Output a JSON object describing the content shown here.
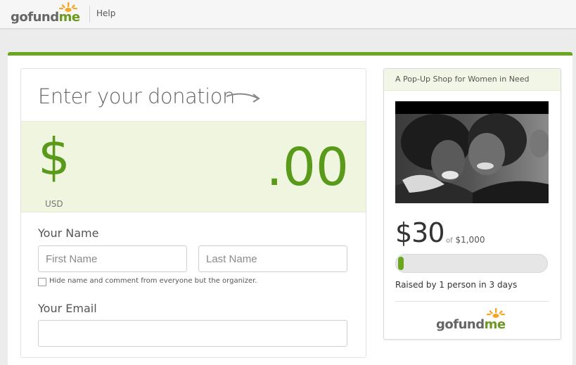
{
  "header": {
    "logo": {
      "go": "go",
      "fund": "fund",
      "me": "me"
    },
    "help_link": "Help"
  },
  "donation": {
    "title": "Enter your donation",
    "currency_symbol": "$",
    "currency_code": "USD",
    "amount_placeholder": ".00",
    "name_label": "Your Name",
    "first_name_placeholder": "First Name",
    "last_name_placeholder": "Last Name",
    "hide_label": "Hide name and comment from everyone but the organizer.",
    "hide_checked": false,
    "email_label": "Your Email",
    "email_value": ""
  },
  "campaign": {
    "title": "A Pop-Up Shop for Women in Need",
    "raised": "$30",
    "of_label": "of",
    "goal": "$1,000",
    "progress_fraction": 0.03,
    "raised_by": "Raised by 1 person in 3 days"
  },
  "colors": {
    "accent_green": "#6aa71f",
    "amount_green": "#5a9a1a",
    "sun_orange": "#f5a623"
  },
  "icons": [
    "logo-sun-icon",
    "arrow-icon"
  ]
}
